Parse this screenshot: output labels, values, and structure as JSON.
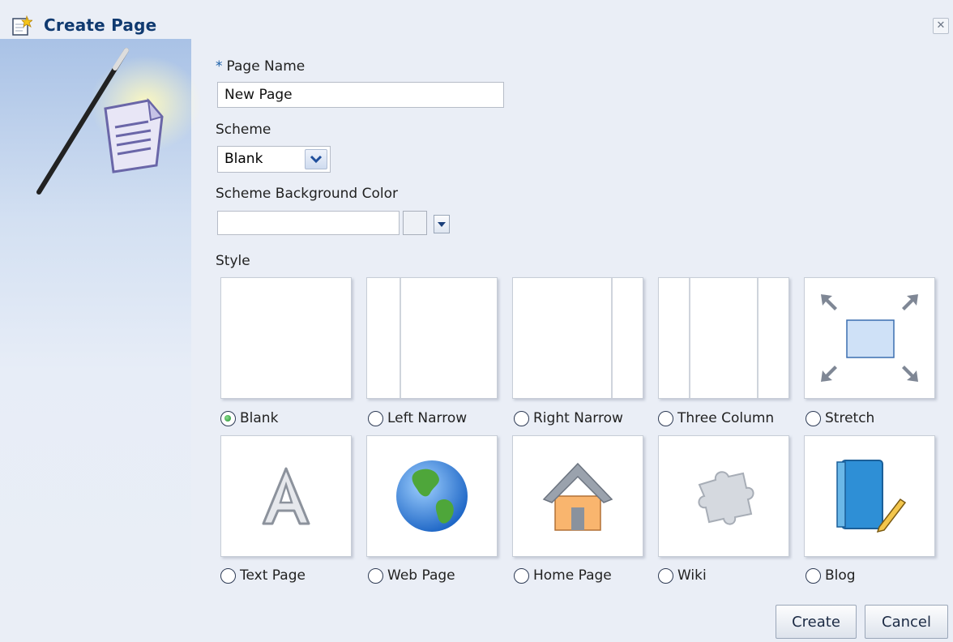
{
  "dialog": {
    "title": "Create Page",
    "close_glyph": "✕"
  },
  "form": {
    "page_name": {
      "required_marker": "*",
      "label": "Page Name",
      "value": "New Page"
    },
    "scheme": {
      "label": "Scheme",
      "selected": "Blank"
    },
    "scheme_bg": {
      "label": "Scheme Background Color",
      "value": ""
    },
    "style_label": "Style"
  },
  "styles": [
    {
      "label": "Blank",
      "checked": true
    },
    {
      "label": "Left Narrow",
      "checked": false
    },
    {
      "label": "Right Narrow",
      "checked": false
    },
    {
      "label": "Three Column",
      "checked": false
    },
    {
      "label": "Stretch",
      "checked": false
    },
    {
      "label": "Text Page",
      "checked": false
    },
    {
      "label": "Web Page",
      "checked": false
    },
    {
      "label": "Home Page",
      "checked": false
    },
    {
      "label": "Wiki",
      "checked": false
    },
    {
      "label": "Blog",
      "checked": false
    }
  ],
  "buttons": {
    "create": "Create",
    "cancel": "Cancel"
  },
  "colors": {
    "title": "#103a70",
    "required": "#1a5fa8",
    "radio_selected": "#1c8a2c",
    "dialog_bg": "#eaeef6"
  }
}
